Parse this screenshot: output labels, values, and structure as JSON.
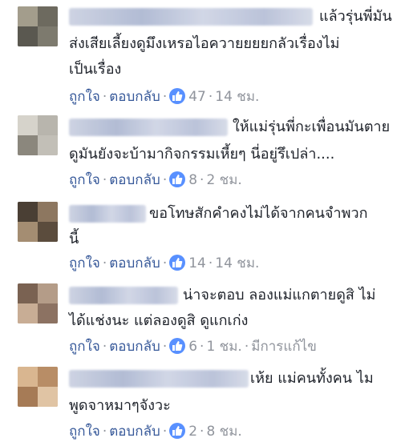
{
  "colors": {
    "link": "#365899",
    "meta": "#90949c",
    "like": "#5890ff",
    "text": "#1d2129"
  },
  "comments": [
    {
      "lines": [
        "แล้วรุ่นพี่มัน",
        "ส่งเสียเลี้ยงดูมึงเหรอไอควายยยยกลัวเรื่องไม่",
        "เป็นเรื่อง"
      ],
      "like_label": "ถูกใจ",
      "reply_label": "ตอบกลับ",
      "likes": "47",
      "time": "14 ชม.",
      "edited": ""
    },
    {
      "lines": [
        "ให้แม่รุ่นพี่กะเพื่อนมันตาย",
        "ดูมันยังจะบ้ามากิจกรรมเหี้ยๆ นี่อยู่รึเปล่า...."
      ],
      "like_label": "ถูกใจ",
      "reply_label": "ตอบกลับ",
      "likes": "8",
      "time": "2 ชม.",
      "edited": ""
    },
    {
      "lines": [
        "ขอโทษสักคำคงไม่ได้จากคนจำพวก",
        "นี้"
      ],
      "like_label": "ถูกใจ",
      "reply_label": "ตอบกลับ",
      "likes": "14",
      "time": "14 ชม.",
      "edited": ""
    },
    {
      "lines": [
        "น่าจะตอบ ลองแม่แกตายดูสิ ไม่",
        "ได้แช่งนะ แต่ลองดูสิ ดูแกเก่ง"
      ],
      "like_label": "ถูกใจ",
      "reply_label": "ตอบกลับ",
      "likes": "6",
      "time": "1 ชม.",
      "edited": "มีการแก้ไข"
    },
    {
      "lines": [
        "เห้ย แม่คนทั้งคน ไม",
        "พูดจาหมาๆจังวะ"
      ],
      "like_label": "ถูกใจ",
      "reply_label": "ตอบกลับ",
      "likes": "2",
      "time": "8 ชม.",
      "edited": ""
    }
  ]
}
